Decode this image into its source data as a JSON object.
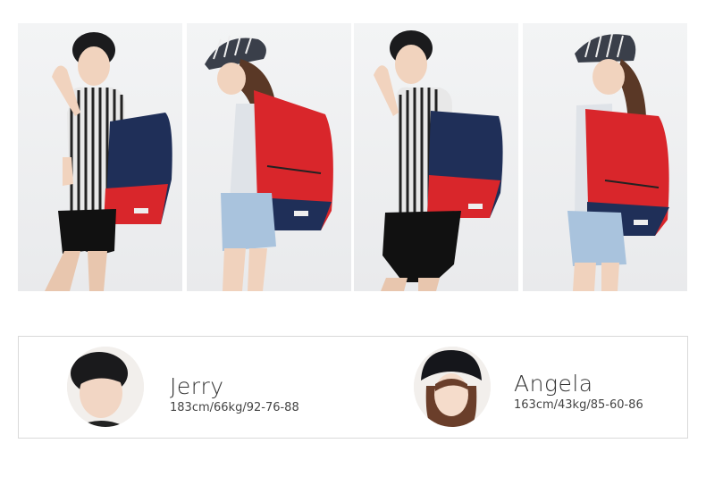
{
  "models": [
    {
      "name": "Jerry",
      "stats": "183cm/66kg/92-76-88"
    },
    {
      "name": "Angela",
      "stats": "163cm/43kg/85-60-86"
    }
  ],
  "colors": {
    "bag_red": "#d9262b",
    "bag_navy": "#1f2f58",
    "shirt_stripe": "#222222",
    "cap": "#3a3f4a"
  }
}
